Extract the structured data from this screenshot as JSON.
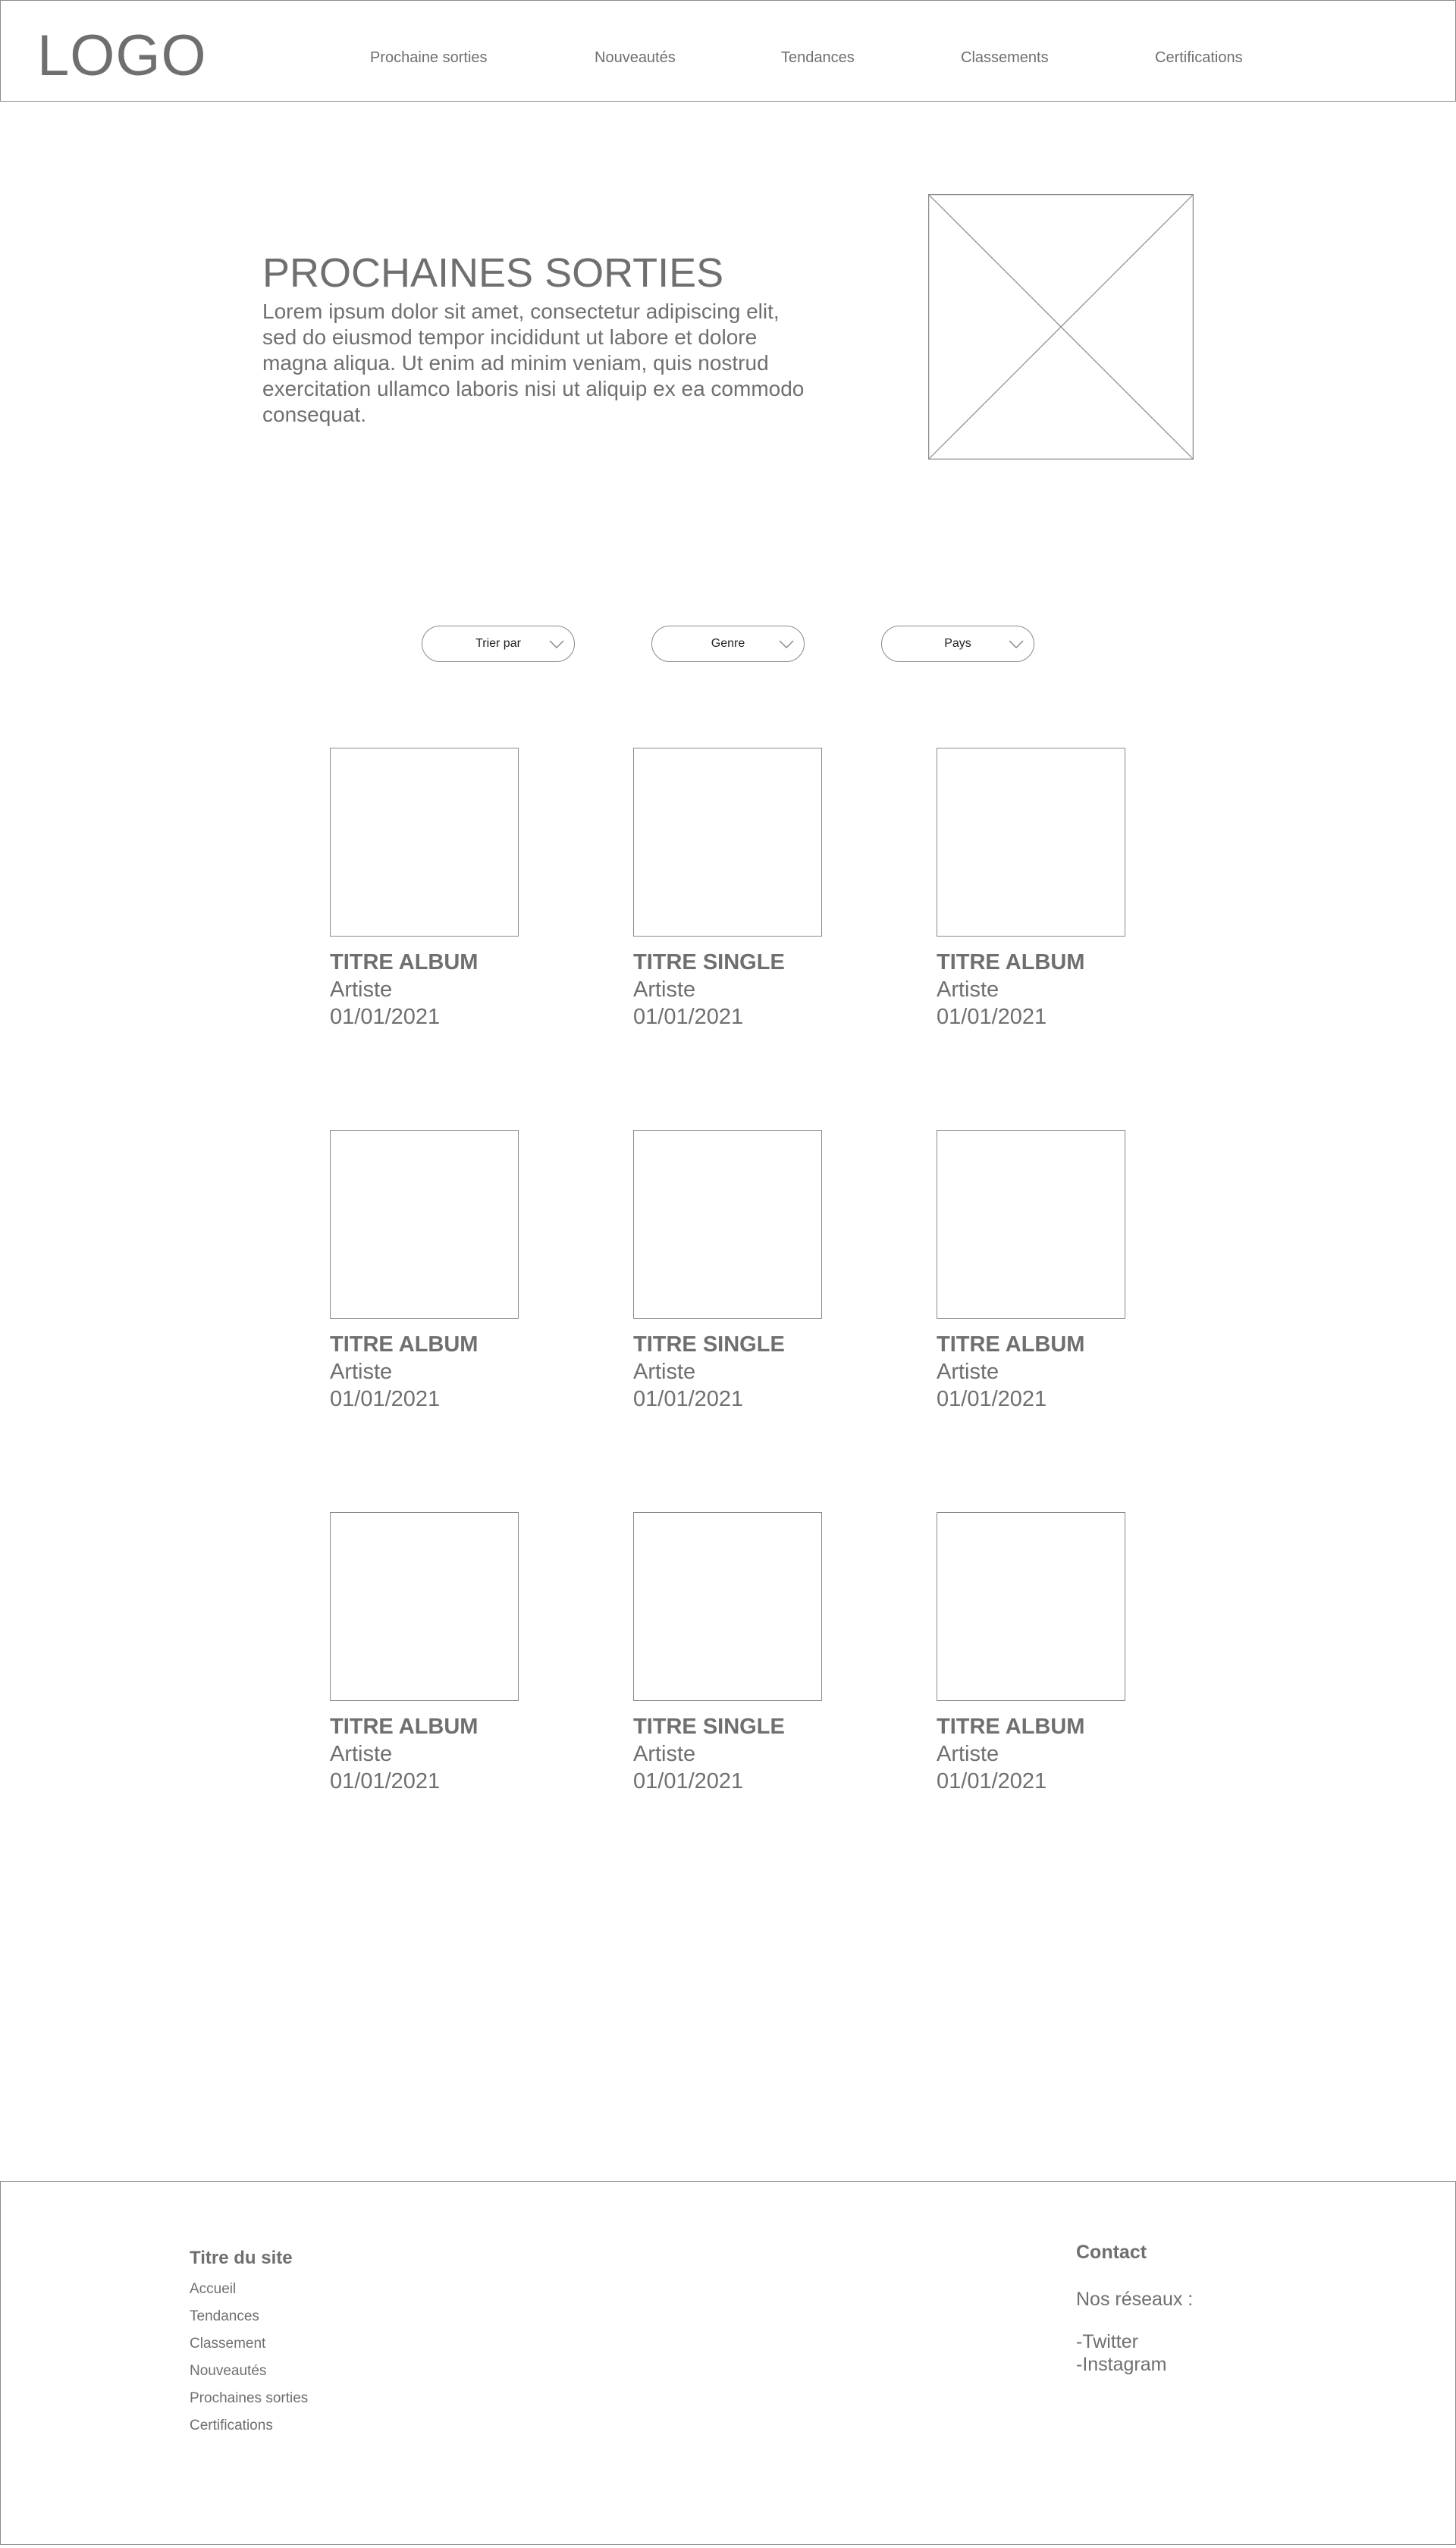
{
  "header": {
    "logo": "LOGO",
    "nav": [
      {
        "label": "Prochaine sorties"
      },
      {
        "label": "Nouveautés"
      },
      {
        "label": "Tendances"
      },
      {
        "label": "Classements"
      },
      {
        "label": "Certifications"
      }
    ]
  },
  "hero": {
    "title": "PROCHAINES SORTIES",
    "description": "Lorem ipsum dolor sit amet, consectetur adipiscing elit, sed do eiusmod tempor incididunt ut labore et dolore magna aliqua. Ut enim ad minim veniam, quis nostrud exercitation ullamco laboris nisi ut aliquip ex ea commodo consequat."
  },
  "filters": [
    {
      "label": "Trier par"
    },
    {
      "label": "Genre"
    },
    {
      "label": "Pays"
    }
  ],
  "releases": [
    {
      "title": "TITRE ALBUM",
      "artist": "Artiste",
      "date": "01/01/2021"
    },
    {
      "title": "TITRE SINGLE",
      "artist": "Artiste",
      "date": "01/01/2021"
    },
    {
      "title": "TITRE ALBUM",
      "artist": "Artiste",
      "date": "01/01/2021"
    },
    {
      "title": "TITRE ALBUM",
      "artist": "Artiste",
      "date": "01/01/2021"
    },
    {
      "title": "TITRE SINGLE",
      "artist": "Artiste",
      "date": "01/01/2021"
    },
    {
      "title": "TITRE ALBUM",
      "artist": "Artiste",
      "date": "01/01/2021"
    },
    {
      "title": "TITRE ALBUM",
      "artist": "Artiste",
      "date": "01/01/2021"
    },
    {
      "title": "TITRE SINGLE",
      "artist": "Artiste",
      "date": "01/01/2021"
    },
    {
      "title": "TITRE ALBUM",
      "artist": "Artiste",
      "date": "01/01/2021"
    }
  ],
  "footer": {
    "site_title": "Titre du site",
    "links": [
      {
        "label": "Accueil"
      },
      {
        "label": "Tendances"
      },
      {
        "label": "Classement"
      },
      {
        "label": "Nouveautés"
      },
      {
        "label": "Prochaines sorties"
      },
      {
        "label": "Certifications"
      }
    ],
    "contact_title": "Contact",
    "networks_label": "Nos réseaux :",
    "networks": [
      {
        "label": "-Twitter"
      },
      {
        "label": "-Instagram"
      }
    ]
  },
  "colors": {
    "text": "#6f6f6f",
    "border": "#8a8a8a",
    "background": "#ffffff"
  }
}
